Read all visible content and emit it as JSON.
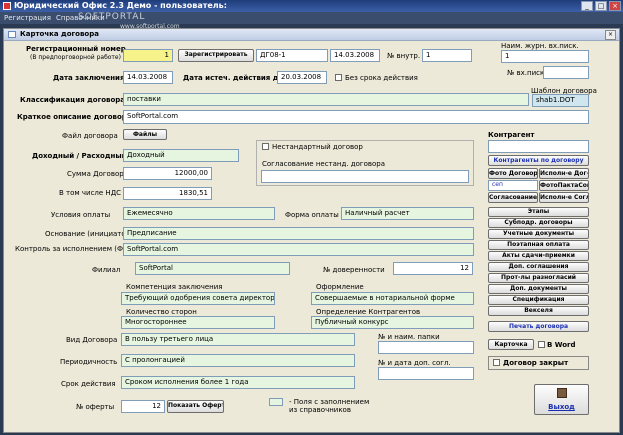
{
  "window": {
    "title": "Юридический Офис 2.3 Демо - пользователь:",
    "watermark": "SOFTPORTAL",
    "watermark_url": "www.softportal.com"
  },
  "menu": {
    "items": [
      "Регистрация",
      "Справочники"
    ]
  },
  "form": {
    "title": "Карточка договора",
    "reg": {
      "label": "Регистрационный номер",
      "sublabel": "(В предпорговорной работе)",
      "value": "1",
      "button": "Зарегистрировать",
      "number": "ДГ08-1",
      "date": "14.03.2008"
    },
    "internal": {
      "label": "№ внутр.",
      "value": "1"
    },
    "incoming": {
      "label": "Наим. журн. вх.писк.",
      "value": "1",
      "num_label": "№ вх.писк.",
      "num_value": ""
    },
    "conclusion": {
      "label": "Дата заключения",
      "value": "14.03.2008",
      "expiry_label": "Дата истеч. действия дог.",
      "expiry_value": "20.03.2008",
      "no_term_label": "Без срока действия"
    },
    "template": {
      "label": "Шаблон договора",
      "value": "shab1.DOT"
    },
    "classification": {
      "label": "Классификация договора",
      "value": "поставки"
    },
    "description": {
      "label": "Краткое описание договора",
      "value": "SoftPortal.com"
    },
    "file": {
      "label": "Файл договора",
      "button": "Файлы"
    },
    "nonstandard": {
      "label": "Нестандартный договор",
      "approval_label": "Согласование нестанд. договора",
      "approval_value": ""
    },
    "income_expense": {
      "label": "Доходный / Расходный",
      "value": "Доходный"
    },
    "sum": {
      "label": "Сумма Договора",
      "value": "12000,00"
    },
    "vat": {
      "label": "В том числе НДС",
      "value": "1830,51"
    },
    "payment_terms": {
      "label": "Условия оплаты",
      "value": "Ежемесячно"
    },
    "payment_form": {
      "label": "Форма оплаты",
      "value": "Наличный расчет"
    },
    "basis": {
      "label": "Основание (инициатор)",
      "value": "Предписание"
    },
    "control": {
      "label": "Контроль за исполнением (ФИО)",
      "value": "SoftPortal.com"
    },
    "branch": {
      "label": "Филиал",
      "value": "SoftPortal"
    },
    "poa": {
      "label": "№ доверенности",
      "value": "12"
    },
    "competence": {
      "label": "Компетенция заключения",
      "value": "Требующий одобрения совета директоров"
    },
    "formalization": {
      "label": "Оформление",
      "value": "Совершаемые в нотариальной форме"
    },
    "parties": {
      "label": "Количество сторон",
      "value": "Многостороннее"
    },
    "counterparty_def": {
      "label": "Определение Контрагентов",
      "value": "Публичный конкурс"
    },
    "contract_type": {
      "label": "Вид Договора",
      "value": "В пользу третьего лица"
    },
    "periodicity": {
      "label": "Периодичность",
      "value": "С пролонгацией"
    },
    "validity": {
      "label": "Срок действия",
      "value": "Сроком исполнения более 1 года"
    },
    "offer": {
      "label": "№ оферты",
      "value": "12",
      "button": "Показать Оферту"
    },
    "folder": {
      "label": "№ и наим. папки",
      "value": ""
    },
    "addendum": {
      "label": "№ и дата доп. согл.",
      "value": ""
    },
    "legend": {
      "text1": "- Поля с заполнением",
      "text2": "из справочников"
    },
    "counterparty": {
      "label": "Контрагент",
      "value": "",
      "list_button": "Контрагенты по договору",
      "photo_button": "Фото Договора",
      "exec_button": "Исполн-е Дог-ра",
      "mini_text": "сеп",
      "photo_akt_button": "ФотоПактаСогл",
      "approval_button": "Согласование",
      "exec2_button": "Исполн-е Согл-я"
    },
    "side_buttons": [
      "Этапы",
      "Субподр. договоры",
      "Учетные документы",
      "Поэтапная оплата",
      "Акты сдачи-приемки",
      "Доп. соглашения",
      "Прот-лы разногласий",
      "Доп. документы",
      "Спецификация",
      "Векселя"
    ],
    "print_button": "Печать договора",
    "card_button": "Карточка",
    "word_label": "В Word",
    "closed_label": "Договор закрыт",
    "exit_button": "Выход"
  }
}
